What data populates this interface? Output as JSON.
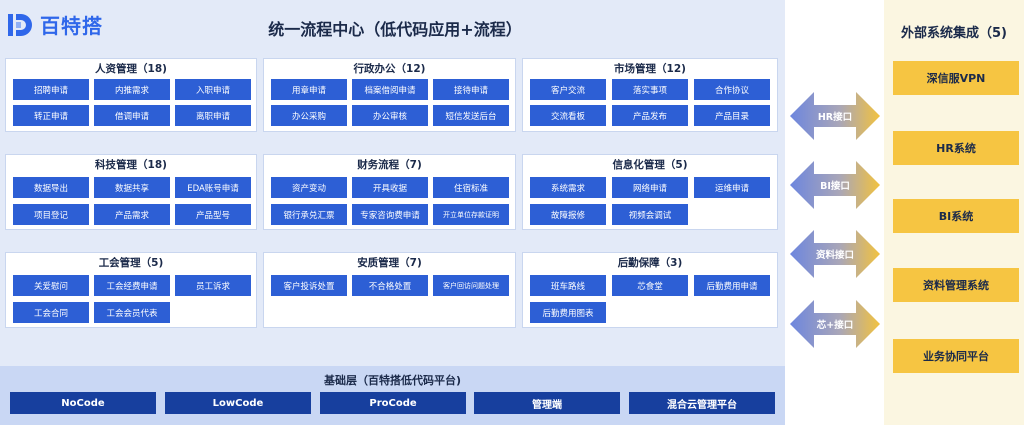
{
  "logo": {
    "text": "百特搭",
    "icon": "logo-d-icon",
    "color": "#2f67ea"
  },
  "center_title": "统一流程中心（低代码应用+流程）",
  "modules": [
    {
      "title": "人资管理（18)",
      "items": [
        "招聘申请",
        "内推需求",
        "入职申请",
        "转正申请",
        "借调申请",
        "离职申请"
      ]
    },
    {
      "title": "行政办公（12)",
      "items": [
        "用章申请",
        "档案借阅申请",
        "接待申请",
        "办公采购",
        "办公审核",
        "短信发送后台"
      ]
    },
    {
      "title": "市场管理（12)",
      "items": [
        "客户交流",
        "落实事项",
        "合作协议",
        "交流看板",
        "产品发布",
        "产品目录"
      ]
    },
    {
      "title": "科技管理（18)",
      "items": [
        "数据导出",
        "数据共享",
        "EDA账号申请",
        "项目登记",
        "产品需求",
        "产品型号"
      ]
    },
    {
      "title": "财务流程（7)",
      "items": [
        "资产变动",
        "开具收据",
        "住宿标准",
        "银行承兑汇票",
        "专家咨询费申请",
        "开立单位存款证明"
      ]
    },
    {
      "title": "信息化管理（5)",
      "items": [
        "系统需求",
        "网络申请",
        "运维申请",
        "故障报修",
        "视频会调试"
      ]
    },
    {
      "title": "工会管理（5)",
      "items": [
        "关爱慰问",
        "工会经费申请",
        "员工诉求",
        "工会合同",
        "工会会员代表"
      ]
    },
    {
      "title": "安质管理（7)",
      "items": [
        "客户投诉处置",
        "不合格处置",
        "客户回访问题处理"
      ]
    },
    {
      "title": "后勤保障（3)",
      "items": [
        "班车路线",
        "芯食堂",
        "后勤费用申请",
        "后勤费用图表"
      ]
    }
  ],
  "base": {
    "title": "基础层（百特搭低代码平台)",
    "items": [
      "NoCode",
      "LowCode",
      "ProCode",
      "管理端",
      "混合云管理平台"
    ]
  },
  "interfaces": [
    "HR接口",
    "BI接口",
    "资料接口",
    "芯+接口"
  ],
  "external": {
    "title": "外部系统集成（5)",
    "items": [
      "深信服VPN",
      "HR系统",
      "BI系统",
      "资料管理系统",
      "业务协同平台"
    ]
  },
  "colors": {
    "main_bg": "#e3eaf8",
    "chip": "#2d5fd5",
    "base_chip": "#173f9e",
    "arrow_blue": "#6d86de",
    "arrow_gold": "#f2c23e",
    "external_bg": "#fbf6e1",
    "external_chip": "#f6c542"
  }
}
